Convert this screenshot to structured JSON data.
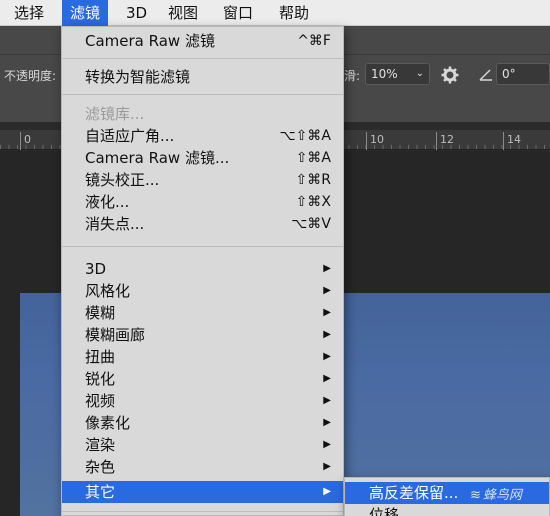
{
  "menubar": {
    "items": [
      {
        "label": "选择",
        "active": false
      },
      {
        "label": "滤镜",
        "active": true
      },
      {
        "label": "3D",
        "active": false
      },
      {
        "label": "视图",
        "active": false
      },
      {
        "label": "窗口",
        "active": false
      },
      {
        "label": "帮助",
        "active": false
      }
    ]
  },
  "options_bar": {
    "opacity_label": "不透明度:",
    "flow_label": "滑:",
    "flow_value": "10%",
    "angle_value": "0°",
    "settings_icon": "gear-icon",
    "angle_icon": "angle-icon"
  },
  "ruler": {
    "labels": [
      "0",
      "10",
      "12",
      "14"
    ]
  },
  "filter_menu": {
    "last_filter": {
      "label": "Camera Raw 滤镜",
      "shortcut": "^⌘F"
    },
    "smart": {
      "label": "转换为智能滤镜"
    },
    "group1": [
      {
        "label": "滤镜库...",
        "shortcut": "",
        "disabled": true
      },
      {
        "label": "自适应广角...",
        "shortcut": "⌥⇧⌘A",
        "disabled": false
      },
      {
        "label": "Camera Raw 滤镜...",
        "shortcut": "⇧⌘A",
        "disabled": false
      },
      {
        "label": "镜头校正...",
        "shortcut": "⇧⌘R",
        "disabled": false
      },
      {
        "label": "液化...",
        "shortcut": "⇧⌘X",
        "disabled": false
      },
      {
        "label": "消失点...",
        "shortcut": "⌥⌘V",
        "disabled": false
      }
    ],
    "submenus": [
      {
        "label": "3D",
        "active": false
      },
      {
        "label": "风格化",
        "active": false
      },
      {
        "label": "模糊",
        "active": false
      },
      {
        "label": "模糊画廊",
        "active": false
      },
      {
        "label": "扭曲",
        "active": false
      },
      {
        "label": "锐化",
        "active": false
      },
      {
        "label": "视频",
        "active": false
      },
      {
        "label": "像素化",
        "active": false
      },
      {
        "label": "渲染",
        "active": false
      },
      {
        "label": "杂色",
        "active": false
      },
      {
        "label": "其它",
        "active": true
      }
    ],
    "arrow_glyph": "▶"
  },
  "other_submenu": {
    "items": [
      {
        "label": "高反差保留...",
        "active": true
      },
      {
        "label": "位移",
        "active": false
      }
    ]
  },
  "watermark": "蜂鸟网",
  "colors": {
    "menu_highlight": "#2a6ae0",
    "menu_bg": "#d9d9d9",
    "canvas_blue": "#4a6aa3"
  }
}
